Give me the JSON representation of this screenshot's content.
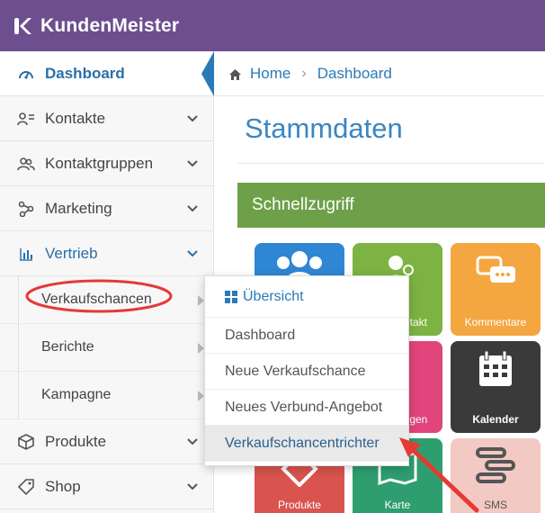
{
  "app": {
    "name": "KundenMeister",
    "brand_color": "#6d4f8f"
  },
  "sidebar": {
    "items": [
      {
        "label": "Dashboard",
        "icon": "gauge-icon"
      },
      {
        "label": "Kontakte",
        "icon": "contacts-icon"
      },
      {
        "label": "Kontaktgruppen",
        "icon": "group-icon"
      },
      {
        "label": "Marketing",
        "icon": "share-icon"
      },
      {
        "label": "Vertrieb",
        "icon": "bar-chart-icon"
      },
      {
        "label": "Produkte",
        "icon": "box-icon"
      },
      {
        "label": "Shop",
        "icon": "tag-icon"
      }
    ],
    "subitems": [
      {
        "label": "Verkaufschancen"
      },
      {
        "label": "Berichte"
      },
      {
        "label": "Kampagne"
      }
    ]
  },
  "breadcrumb": {
    "home": "Home",
    "current": "Dashboard"
  },
  "main": {
    "title": "Stammdaten",
    "panel_title": "Schnellzugriff",
    "tiles": [
      {
        "label": "",
        "color": "#2f86d4"
      },
      {
        "label": "ntakt",
        "color": "#7cb342"
      },
      {
        "label": "Kommentare",
        "color": "#f4a640"
      },
      {
        "label": "ngen",
        "color": "#e0457b"
      },
      {
        "label": "Kalender",
        "color": "#3a3a3a"
      },
      {
        "label": "Produkte",
        "color": "#d9534f"
      },
      {
        "label": "Karte",
        "color": "#2e9e6e"
      },
      {
        "label": "SMS",
        "color": "#f3c9c4"
      }
    ]
  },
  "dropdown": {
    "header": "Übersicht",
    "items": [
      "Dashboard",
      "Neue Verkaufschance",
      "Neues Verbund-Angebot",
      "Verkaufschancentrichter"
    ]
  }
}
